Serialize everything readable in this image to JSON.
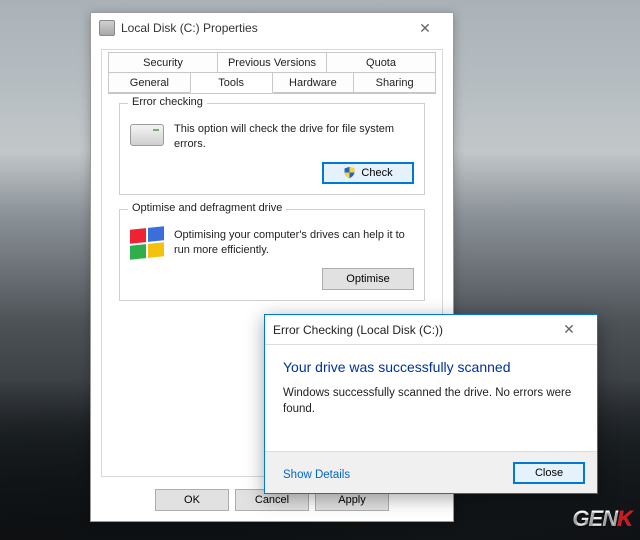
{
  "properties": {
    "title": "Local Disk (C:) Properties",
    "tabs_row1": [
      "Security",
      "Previous Versions",
      "Quota"
    ],
    "tabs_row2": [
      "General",
      "Tools",
      "Hardware",
      "Sharing"
    ],
    "active_tab": "Tools",
    "error_checking": {
      "legend": "Error checking",
      "desc": "This option will check the drive for file system errors.",
      "button": "Check"
    },
    "optimise": {
      "legend": "Optimise and defragment drive",
      "desc": "Optimising your computer's drives can help it to run more efficiently.",
      "button": "Optimise"
    },
    "footer": {
      "ok": "OK",
      "cancel": "Cancel",
      "apply": "Apply"
    }
  },
  "dialog": {
    "title": "Error Checking (Local Disk (C:))",
    "headline": "Your drive was successfully scanned",
    "message": "Windows successfully scanned the drive. No errors were found.",
    "show_details": "Show Details",
    "close": "Close"
  },
  "watermark": {
    "gen": "GEN",
    "k": "K"
  }
}
